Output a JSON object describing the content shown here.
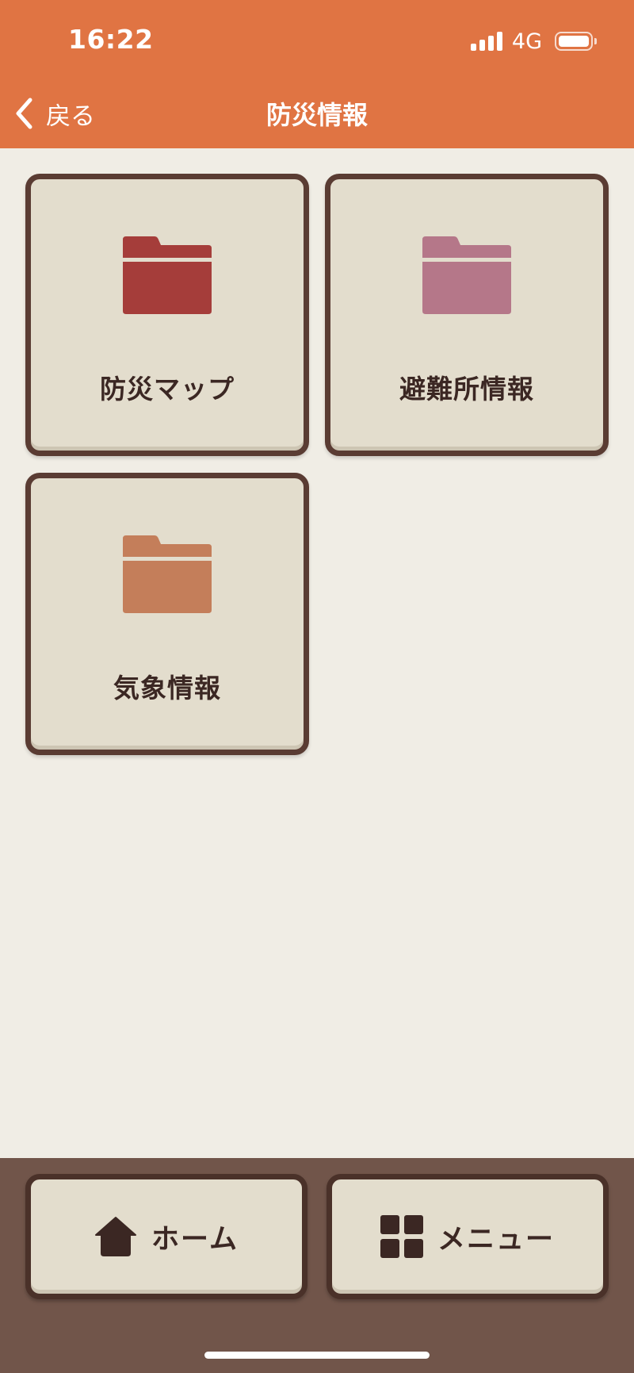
{
  "status_bar": {
    "time": "16:22",
    "network": "4G"
  },
  "nav": {
    "back_label": "戻る",
    "title": "防災情報"
  },
  "cards": [
    {
      "label": "防災マップ",
      "icon": "folder-icon",
      "color": "#a53d3a"
    },
    {
      "label": "避難所情報",
      "icon": "folder-icon",
      "color": "#b57789"
    },
    {
      "label": "気象情報",
      "icon": "folder-icon",
      "color": "#c47e5a"
    }
  ],
  "tabbar": {
    "home_label": "ホーム",
    "menu_label": "メニュー"
  },
  "colors": {
    "header": "#e07443",
    "background": "#f0ede5",
    "card_face": "#e3ddcd",
    "card_border": "#5a3c33",
    "tabbar": "#71554a",
    "text": "#3b2723"
  }
}
